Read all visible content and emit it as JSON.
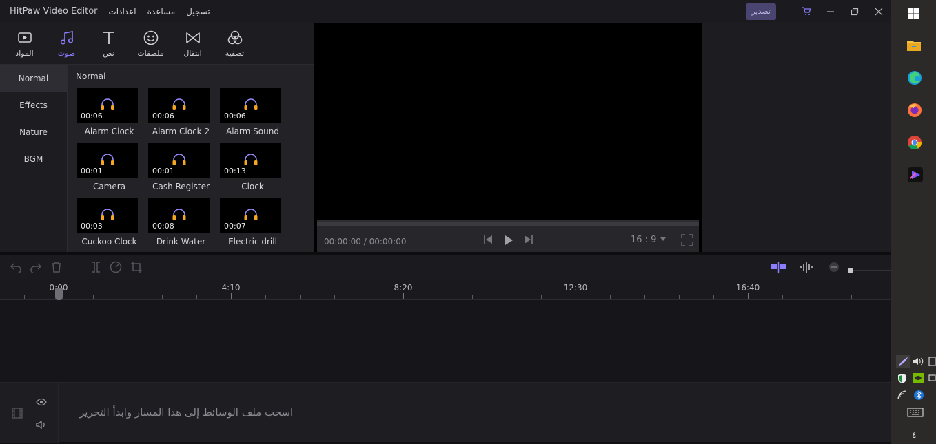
{
  "window": {
    "app_title": "HitPaw Video Editor",
    "menu": [
      "تسجيل",
      "مساعدة",
      "اعدادات"
    ],
    "export_label": "تصدير"
  },
  "tools": [
    {
      "label": "المواد",
      "icon": "media-icon"
    },
    {
      "label": "صوت",
      "icon": "music-icon",
      "active": true
    },
    {
      "label": "نص",
      "icon": "text-icon"
    },
    {
      "label": "ملصقات",
      "icon": "sticker-icon"
    },
    {
      "label": "انتقال",
      "icon": "transition-icon"
    },
    {
      "label": "تصفية",
      "icon": "filter-icon"
    }
  ],
  "categories": [
    "Normal",
    "Effects",
    "Nature",
    "BGM"
  ],
  "library": {
    "section_title": "Normal",
    "clips": [
      {
        "name": "Alarm Clock",
        "duration": "00:06"
      },
      {
        "name": "Alarm Clock 2",
        "duration": "00:06"
      },
      {
        "name": "Alarm Sound",
        "duration": "00:06"
      },
      {
        "name": "Camera",
        "duration": "00:01"
      },
      {
        "name": "Cash Register",
        "duration": "00:01"
      },
      {
        "name": "Clock",
        "duration": "00:13"
      },
      {
        "name": "Cuckoo Clock",
        "duration": "00:03"
      },
      {
        "name": "Drink Water",
        "duration": "00:08"
      },
      {
        "name": "Electric drill",
        "duration": "00:07"
      }
    ]
  },
  "player": {
    "time": "00:00:00 / 00:00:00",
    "ratio": "16 : 9"
  },
  "timeline": {
    "ruler_labels": [
      "0:00",
      "4:10",
      "8:20",
      "12:30",
      "16:40"
    ],
    "track_hint": "اسحب ملف الوسائط إلى هذا المسار وابدأ التحرير"
  },
  "taskbar": {
    "clock_text": "٤"
  },
  "colors": {
    "accent": "#8b7dff",
    "headphone": "#f5a623",
    "export_bg": "#4a4570"
  }
}
